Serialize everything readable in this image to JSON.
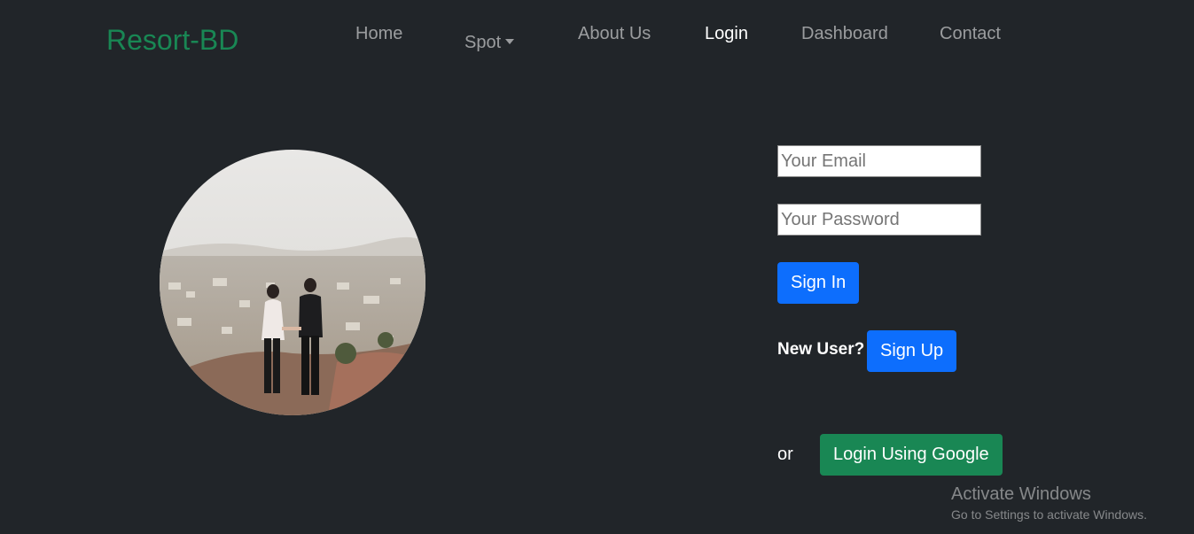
{
  "navbar": {
    "brand": "Resort-BD",
    "links": {
      "home": "Home",
      "spot": "Spot",
      "about": "About Us",
      "login": "Login",
      "dashboard": "Dashboard",
      "contact": "Contact"
    },
    "active": "Login"
  },
  "form": {
    "email_placeholder": "Your Email",
    "password_placeholder": "Your Password",
    "signin_label": "Sign In",
    "new_user_label": "New User?",
    "signup_label": "Sign Up",
    "or_label": "or",
    "google_label": "Login Using Google"
  },
  "hero": {
    "image_alt": "couple-overlooking-city-photo"
  },
  "watermark": {
    "title": "Activate Windows",
    "subtitle": "Go to Settings to activate Windows."
  },
  "colors": {
    "background": "#212529",
    "brand": "#198754",
    "primary": "#0d6efd",
    "success": "#198754"
  }
}
